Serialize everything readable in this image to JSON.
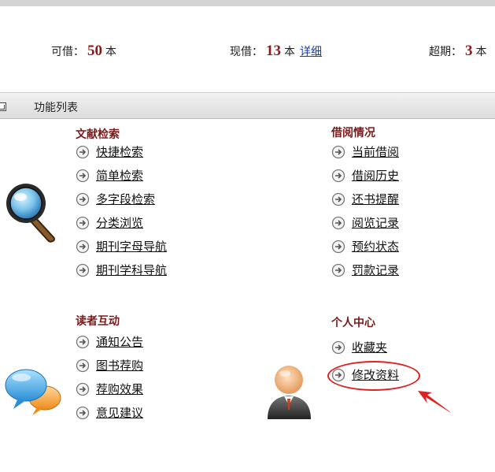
{
  "stats": {
    "borrowable_label": "可借：",
    "borrowable_value": "50",
    "borrowable_unit": "本",
    "current_label": "现借：",
    "current_value": "13",
    "current_unit": "本",
    "detail_link": "详细",
    "overdue_label": "超期：",
    "overdue_value": "3",
    "overdue_unit": "本"
  },
  "function_bar": {
    "title": "功能列表"
  },
  "sections": {
    "search": {
      "title": "文献检索",
      "items": [
        "快捷检索",
        "简单检索",
        "多字段检索",
        "分类浏览",
        "期刊字母导航",
        "期刊学科导航"
      ]
    },
    "borrow": {
      "title": "借阅情况",
      "items": [
        "当前借阅",
        "借阅历史",
        "还书提醒",
        "阅览记录",
        "预约状态",
        "罚款记录"
      ]
    },
    "interact": {
      "title": "读者互动",
      "items": [
        "通知公告",
        "图书荐购",
        "荐购效果",
        "意见建议"
      ]
    },
    "personal": {
      "title": "个人中心",
      "items": [
        "收藏夹",
        "修改资料"
      ]
    }
  },
  "icons": {
    "link_arrow": "circle-arrow-right-icon",
    "search_section": "magnifier-icon",
    "interact_section": "chat-bubbles-icon",
    "personal_section": "person-icon"
  },
  "colors": {
    "accent_number": "#8b1a1a",
    "section_title": "#7a1a1a",
    "annotation": "#e02020",
    "link": "#1a3fa0"
  }
}
